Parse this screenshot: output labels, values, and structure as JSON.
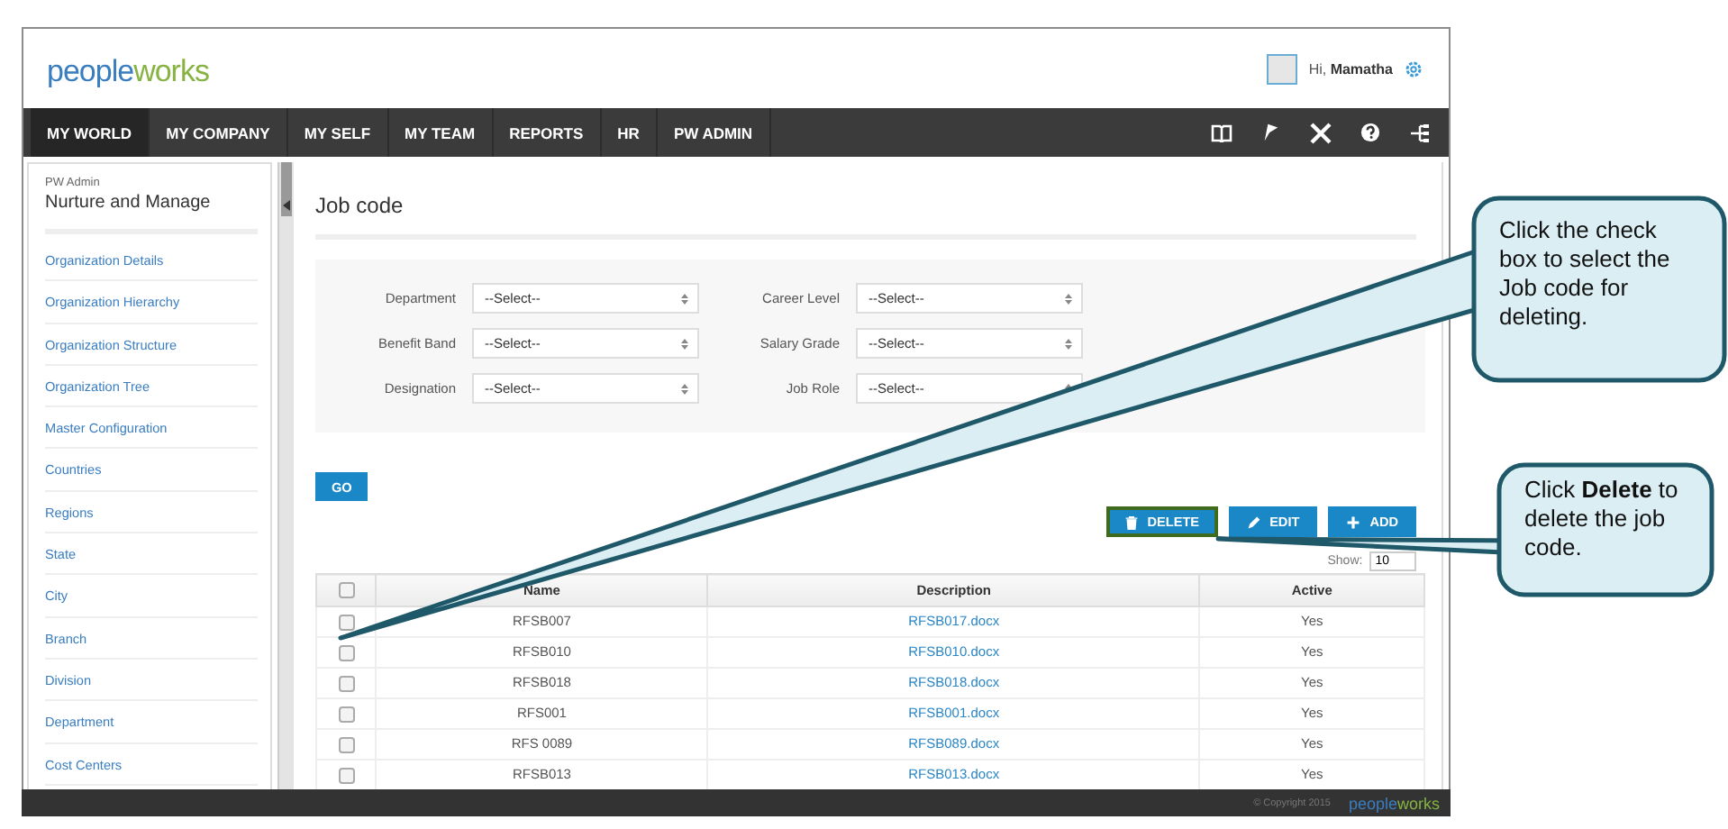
{
  "header": {
    "logo": [
      "people",
      "works"
    ],
    "greeting": "Hi,",
    "user": "Mamatha"
  },
  "nav": {
    "items": [
      {
        "label": "MY WORLD",
        "selected": true
      },
      {
        "label": "MY COMPANY",
        "selected": false
      },
      {
        "label": "MY SELF",
        "selected": false
      },
      {
        "label": "MY TEAM",
        "selected": false
      },
      {
        "label": "REPORTS",
        "selected": false
      },
      {
        "label": "HR",
        "selected": false
      },
      {
        "label": "PW ADMIN",
        "selected": false
      }
    ]
  },
  "sidebar": {
    "section": "PW Admin",
    "title": "Nurture and Manage",
    "items": [
      "Organization Details",
      "Organization Hierarchy",
      "Organization Structure",
      "Organization Tree",
      "Master Configuration",
      "Countries",
      "Regions",
      "State",
      "City",
      "Branch",
      "Division",
      "Department",
      "Cost Centers"
    ]
  },
  "page": {
    "title": "Job code"
  },
  "filters": [
    {
      "label": "Department",
      "value": "--Select--"
    },
    {
      "label": "Career Level",
      "value": "--Select--"
    },
    {
      "label": "Benefit Band",
      "value": "--Select--"
    },
    {
      "label": "Salary Grade",
      "value": "--Select--"
    },
    {
      "label": "Designation",
      "value": "--Select--"
    },
    {
      "label": "Job Role",
      "value": "--Select--"
    }
  ],
  "go_button": "GO",
  "actions": [
    {
      "kind": "delete",
      "label": "DELETE",
      "highlighted": true
    },
    {
      "kind": "edit",
      "label": "EDIT",
      "highlighted": false
    },
    {
      "kind": "add",
      "label": "ADD",
      "highlighted": false
    }
  ],
  "show": {
    "label": "Show:",
    "value": "10"
  },
  "table": {
    "columns": [
      "Name",
      "Description",
      "Active"
    ],
    "header_checked": false,
    "rows": [
      {
        "checked": false,
        "name": "RFSB007",
        "description": "RFSB017.docx",
        "active": "Yes"
      },
      {
        "checked": false,
        "name": "RFSB010",
        "description": "RFSB010.docx",
        "active": "Yes"
      },
      {
        "checked": false,
        "name": "RFSB018",
        "description": "RFSB018.docx",
        "active": "Yes"
      },
      {
        "checked": false,
        "name": "RFS001",
        "description": "RFSB001.docx",
        "active": "Yes"
      },
      {
        "checked": false,
        "name": "RFS 0089",
        "description": "RFSB089.docx",
        "active": "Yes"
      },
      {
        "checked": false,
        "name": "RFSB013",
        "description": "RFSB013.docx",
        "active": "Yes"
      }
    ]
  },
  "footer": {
    "copyright": "© Copyright 2015",
    "logo": [
      "people",
      "works"
    ]
  },
  "callouts": [
    {
      "text": "Click the check box to select the Job code for deleting."
    },
    {
      "text": "Click **Delete** to delete the job code."
    }
  ]
}
